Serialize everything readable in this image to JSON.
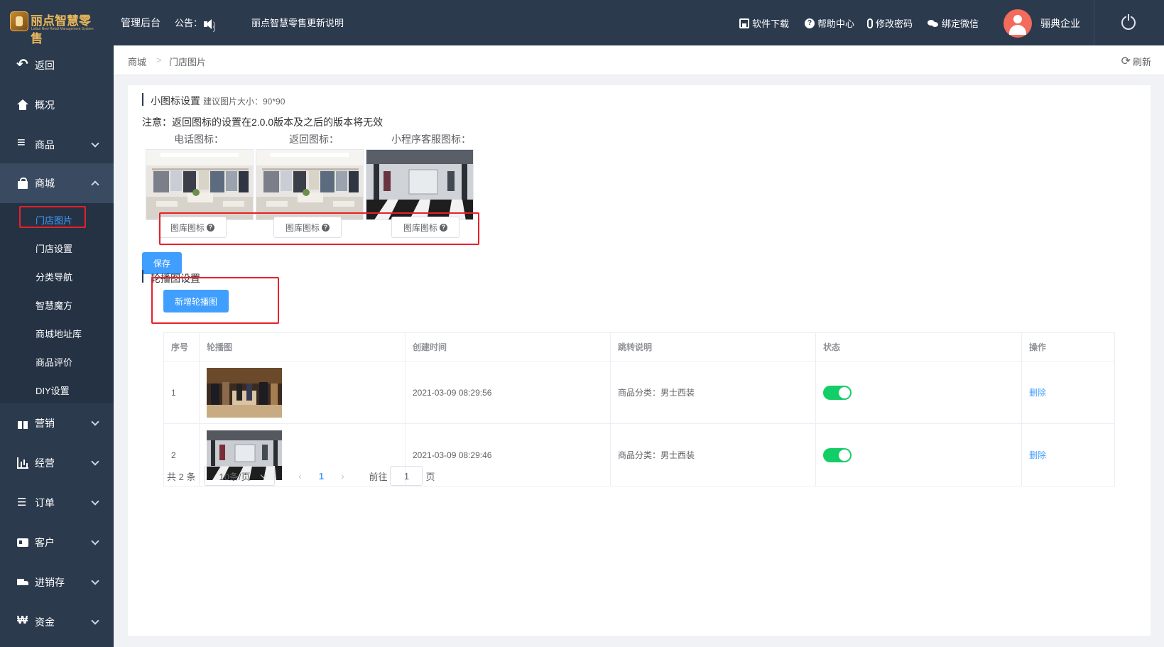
{
  "topbar": {
    "logo_text": "丽点智慧零售",
    "logo_sub": "Lidian New Retail Management System",
    "admin_label": "管理后台",
    "notice_label": "公告：",
    "update_note": "丽点智慧零售更新说明",
    "tools": [
      "软件下载",
      "帮助中心",
      "修改密码",
      "绑定微信"
    ],
    "user_name": "骊典企业"
  },
  "sidebar": {
    "items": [
      {
        "label": "返回",
        "icon": "back-arrow-icon"
      },
      {
        "label": "概况",
        "icon": "home-icon"
      },
      {
        "label": "商品",
        "icon": "list-icon"
      },
      {
        "label": "商城",
        "icon": "shopping-bag-icon"
      },
      {
        "label": "营销",
        "icon": "gift-icon"
      },
      {
        "label": "经营",
        "icon": "bar-chart-icon"
      },
      {
        "label": "订单",
        "icon": "order-list-icon"
      },
      {
        "label": "客户",
        "icon": "id-card-icon"
      },
      {
        "label": "进销存",
        "icon": "truck-icon"
      },
      {
        "label": "资金",
        "icon": "won-icon"
      }
    ],
    "submenu": [
      "门店图片",
      "门店设置",
      "分类导航",
      "智慧魔方",
      "商城地址库",
      "商品评价",
      "DIY设置"
    ],
    "active_sub": "门店图片"
  },
  "breadcrumb": {
    "items": [
      "商城",
      "门店图片"
    ],
    "separator": ">",
    "refresh_label": "刷新"
  },
  "icon_settings": {
    "title": "小图标设置",
    "hint": "建议图片大小：90*90",
    "notice": "注意：返回图标的设置在2.0.0版本及之后的版本将无效",
    "labels": [
      "电话图标：",
      "返回图标：",
      "小程序客服图标："
    ],
    "pick_label": "图库图标",
    "save_label": "保存"
  },
  "carousel": {
    "title": "轮播图设置",
    "add_label": "新增轮播图",
    "columns": [
      "序号",
      "轮播图",
      "创建时间",
      "跳转说明",
      "状态",
      "操作"
    ],
    "rows": [
      {
        "index": "1",
        "created": "2021-03-09 08:29:56",
        "jump": "商品分类：男士西装",
        "enabled": true,
        "action": "删除"
      },
      {
        "index": "2",
        "created": "2021-03-09 08:29:46",
        "jump": "商品分类：男士西装",
        "enabled": true,
        "action": "删除"
      }
    ]
  },
  "pagination": {
    "total": "共 2 条",
    "page_size": "10条/页",
    "current_page": "1",
    "goto_label": "前往",
    "goto_value": "1",
    "page_suffix": "页"
  },
  "colors": {
    "sidebar_bg": "#2c3a4e",
    "primary": "#409eff",
    "switch_on": "#13ce66",
    "highlight_box": "#e8202a"
  }
}
